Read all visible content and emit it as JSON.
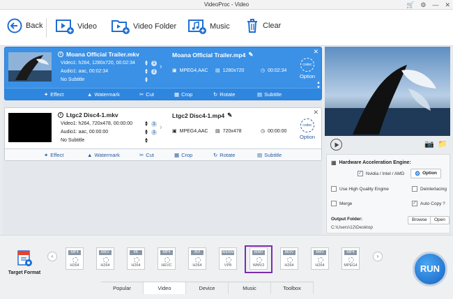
{
  "window": {
    "title": "VideoProc - Video",
    "controls": [
      "cart-icon",
      "gear-icon",
      "minimize-icon",
      "close-icon"
    ]
  },
  "toolbar": {
    "back": "Back",
    "video": "Video",
    "video_folder": "Video Folder",
    "music": "Music",
    "clear": "Clear"
  },
  "tasks": [
    {
      "source_name": "Moana Official Trailer.mkv",
      "video_line": "Video1: h264, 1280x720, 00:02:34",
      "audio_line": "Audio1: aac, 00:02:34",
      "subtitle_line": "No Subtitle",
      "output_name": "Moana Official Trailer.mp4",
      "output_format": "MPEG4,AAC",
      "output_resolution": "1280x720",
      "output_duration": "00:02:34",
      "codec_label": "codec",
      "option_label": "Option",
      "badge": "1",
      "selected": true
    },
    {
      "source_name": "Ltgc2 Disc4-1.mkv",
      "video_line": "Video1: h264, 720x478, 00:00:00",
      "audio_line": "Audio1: aac, 00:00:00",
      "subtitle_line": "No Subtitle",
      "output_name": "Ltgc2 Disc4-1.mp4",
      "output_format": "MPEG4,AAC",
      "output_resolution": "720x478",
      "output_duration": "00:00:00",
      "codec_label": "codec",
      "option_label": "Option",
      "badge": "1",
      "selected": false
    }
  ],
  "edit_tools": [
    "Effect",
    "Watermark",
    "Cut",
    "Crop",
    "Rotate",
    "Subtitle"
  ],
  "settings": {
    "hw_title": "Hardware Acceleration Engine:",
    "nvidia_label": "Nvidia / Intel / AMD",
    "option_button": "Option",
    "use_high_quality": "Use High Quality Engine",
    "deinterlacing": "Deinterlacing",
    "merge": "Merge",
    "auto_copy": "Auto Copy ?",
    "output_folder_label": "Output Folder:",
    "output_path": "C:\\Users\\12\\Desktop",
    "browse": "Browse",
    "open": "Open"
  },
  "format_bar": {
    "target_format": "Target Format",
    "formats": [
      {
        "top": "MP4",
        "bottom": "H264"
      },
      {
        "top": "MKV",
        "bottom": "H264"
      },
      {
        "top": "4K",
        "bottom": "H264"
      },
      {
        "top": "MP4",
        "bottom": "HEVC"
      },
      {
        "top": "AVI",
        "bottom": "H264"
      },
      {
        "top": "WEBM",
        "bottom": "VP8"
      },
      {
        "top": "WMV",
        "bottom": "WMV2"
      },
      {
        "top": "MOV",
        "bottom": "H264"
      },
      {
        "top": "M4V",
        "bottom": "H264"
      },
      {
        "top": "MP4",
        "bottom": "MPEG4"
      }
    ],
    "selected_index": 6,
    "tabs": [
      "Popular",
      "Video",
      "Device",
      "Music",
      "Toolbox"
    ],
    "active_tab": 1,
    "run_label": "RUN"
  }
}
